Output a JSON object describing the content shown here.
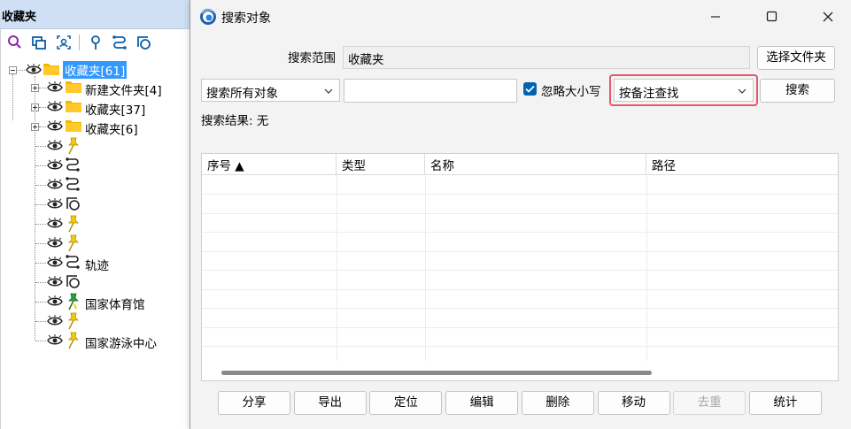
{
  "favorites": {
    "title": "收藏夹",
    "toolbar": [
      "search-icon",
      "copy-icon",
      "locate-icon",
      "pin-icon",
      "route-icon",
      "shapes-icon"
    ],
    "tree": {
      "root_label": "收藏夹[61]",
      "children": [
        {
          "label": "新建文件夹[4]",
          "type": "folder"
        },
        {
          "label": "收藏夹[37]",
          "type": "folder"
        },
        {
          "label": "收藏夹[6]",
          "type": "folder"
        },
        {
          "label": "",
          "type": "pushpin"
        },
        {
          "label": "",
          "type": "route"
        },
        {
          "label": "",
          "type": "route"
        },
        {
          "label": "",
          "type": "shape"
        },
        {
          "label": "",
          "type": "pushpin"
        },
        {
          "label": "",
          "type": "pushpin"
        },
        {
          "label": "轨迹",
          "type": "route"
        },
        {
          "label": "",
          "type": "shape"
        },
        {
          "label": "国家体育馆",
          "type": "green-pushpin"
        },
        {
          "label": "",
          "type": "pushpin"
        },
        {
          "label": "国家游泳中心",
          "type": "pushpin"
        }
      ]
    }
  },
  "dialog": {
    "title": "搜索对象",
    "scope_label": "搜索范围",
    "scope_value": "收藏夹",
    "choose_folder": "选择文件夹",
    "object_type": "搜索所有对象",
    "keyword": "",
    "ignore_case_label": "忽略大小写",
    "ignore_case_checked": true,
    "search_mode": "按备注查找",
    "search_button": "搜索",
    "result_label": "搜索结果: 无",
    "columns": [
      "序号 ▲",
      "类型",
      "名称",
      "路径"
    ],
    "buttons": [
      {
        "label": "分享",
        "enabled": true
      },
      {
        "label": "导出",
        "enabled": true
      },
      {
        "label": "定位",
        "enabled": true
      },
      {
        "label": "编辑",
        "enabled": true
      },
      {
        "label": "删除",
        "enabled": true
      },
      {
        "label": "移动",
        "enabled": true
      },
      {
        "label": "去重",
        "enabled": false
      },
      {
        "label": "统计",
        "enabled": true
      }
    ]
  },
  "colors": {
    "accent": "#0063b1",
    "selection": "#3399ff",
    "highlight": "#e8566b",
    "folder": "#f7b500",
    "pushpin": "#f2cc0c",
    "green_pin": "#2e9d3a"
  }
}
